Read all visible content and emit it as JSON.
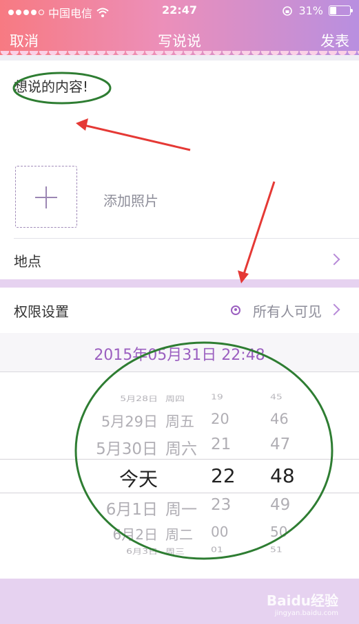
{
  "status": {
    "carrier": "中国电信",
    "time": "22:47",
    "battery": "31%"
  },
  "nav": {
    "cancel": "取消",
    "title": "写说说",
    "publish": "发表"
  },
  "compose": {
    "placeholder": "想说的内容!"
  },
  "photo": {
    "label": "添加照片"
  },
  "location": {
    "label": "地点"
  },
  "permission": {
    "label": "权限设置",
    "value": "所有人可见"
  },
  "datetime": {
    "current": "2015年05月31日 22:48"
  },
  "picker": {
    "rows": [
      {
        "date": "5月28日",
        "weekday": "周四",
        "hour": "19",
        "minute": "45"
      },
      {
        "date": "5月29日",
        "weekday": "周五",
        "hour": "20",
        "minute": "46"
      },
      {
        "date": "5月30日",
        "weekday": "周六",
        "hour": "21",
        "minute": "47"
      },
      {
        "date": "今天",
        "weekday": "",
        "hour": "22",
        "minute": "48"
      },
      {
        "date": "6月1日",
        "weekday": "周一",
        "hour": "23",
        "minute": "49"
      },
      {
        "date": "6月2日",
        "weekday": "周二",
        "hour": "00",
        "minute": "50"
      },
      {
        "date": "6月3日",
        "weekday": "周三",
        "hour": "01",
        "minute": "51"
      }
    ]
  },
  "watermark": {
    "brand": "Baidu经验",
    "url": "jingyan.baidu.com"
  },
  "colors": {
    "accent": "#9b5fc0",
    "annotation_green": "#2e7d32",
    "annotation_red": "#e53935"
  }
}
